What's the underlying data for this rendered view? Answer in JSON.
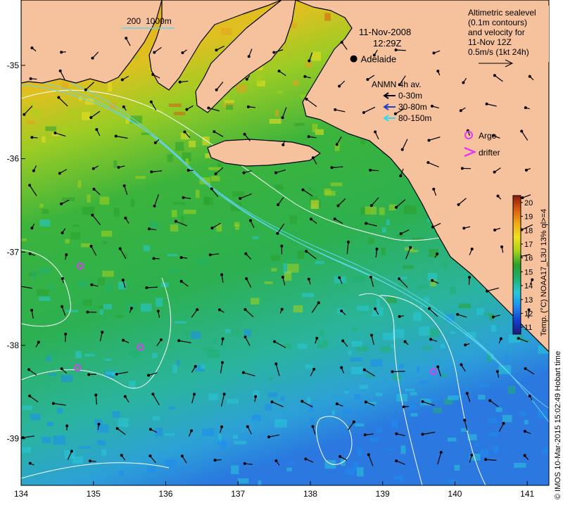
{
  "map": {
    "lon_range": [
      134,
      141.3
    ],
    "lat_range": [
      -39.5,
      -34.3
    ],
    "x_ticks": [
      "134",
      "135",
      "136",
      "137",
      "138",
      "139",
      "140",
      "141"
    ],
    "x_tick_values": [
      134,
      135,
      136,
      137,
      138,
      139,
      140,
      141
    ],
    "y_ticks": [
      "-35",
      "-36",
      "-37",
      "-38",
      "-39"
    ],
    "y_tick_values": [
      -35,
      -36,
      -37,
      -38,
      -39
    ]
  },
  "header": {
    "date": "11-Nov-2008",
    "time": "12:29Z"
  },
  "scale_bar": {
    "label_200": "200",
    "label_1000": "1000m"
  },
  "altimetry_note": {
    "line1": "Altimetric sealevel",
    "line2": "(0.1m contours)",
    "line3": "and velocity for",
    "line4": "11-Nov 12Z",
    "line5": "0.5m/s (1kt 24h)"
  },
  "city": {
    "name": "Adelaide",
    "lon": 138.6,
    "lat": -34.93
  },
  "anmn_legend": {
    "title": "ANMN 4h av.",
    "items": [
      {
        "label": "0-30m",
        "color": "#000000"
      },
      {
        "label": "30-80m",
        "color": "#1f3fbf"
      },
      {
        "label": "80-150m",
        "color": "#35d7f0"
      }
    ]
  },
  "markers_legend": {
    "argo": "Argo",
    "drifter": "drifter",
    "argo_color": "#e03cf0",
    "drifter_color": "#e03cf0"
  },
  "argo_floats": [
    {
      "lon": 134.82,
      "lat": -37.15
    },
    {
      "lon": 135.65,
      "lat": -38.02
    },
    {
      "lon": 134.78,
      "lat": -38.24
    },
    {
      "lon": 139.7,
      "lat": -38.28
    }
  ],
  "colorbar": {
    "ticks": [
      "20",
      "19",
      "18",
      "17",
      "16",
      "15",
      "14",
      "13",
      "12",
      "11"
    ],
    "min": 10.5,
    "max": 20.5,
    "title": "Temp. (°C) NOAA17_L3U 13% ql>=4"
  },
  "timestamp": "© IMOS 10-Mar-2015 15:02:49 Hobart time",
  "colors": {
    "land": "#f6c19d",
    "coast": "#000000",
    "contour": "#ffffff",
    "isobath": "#60d4f0"
  }
}
